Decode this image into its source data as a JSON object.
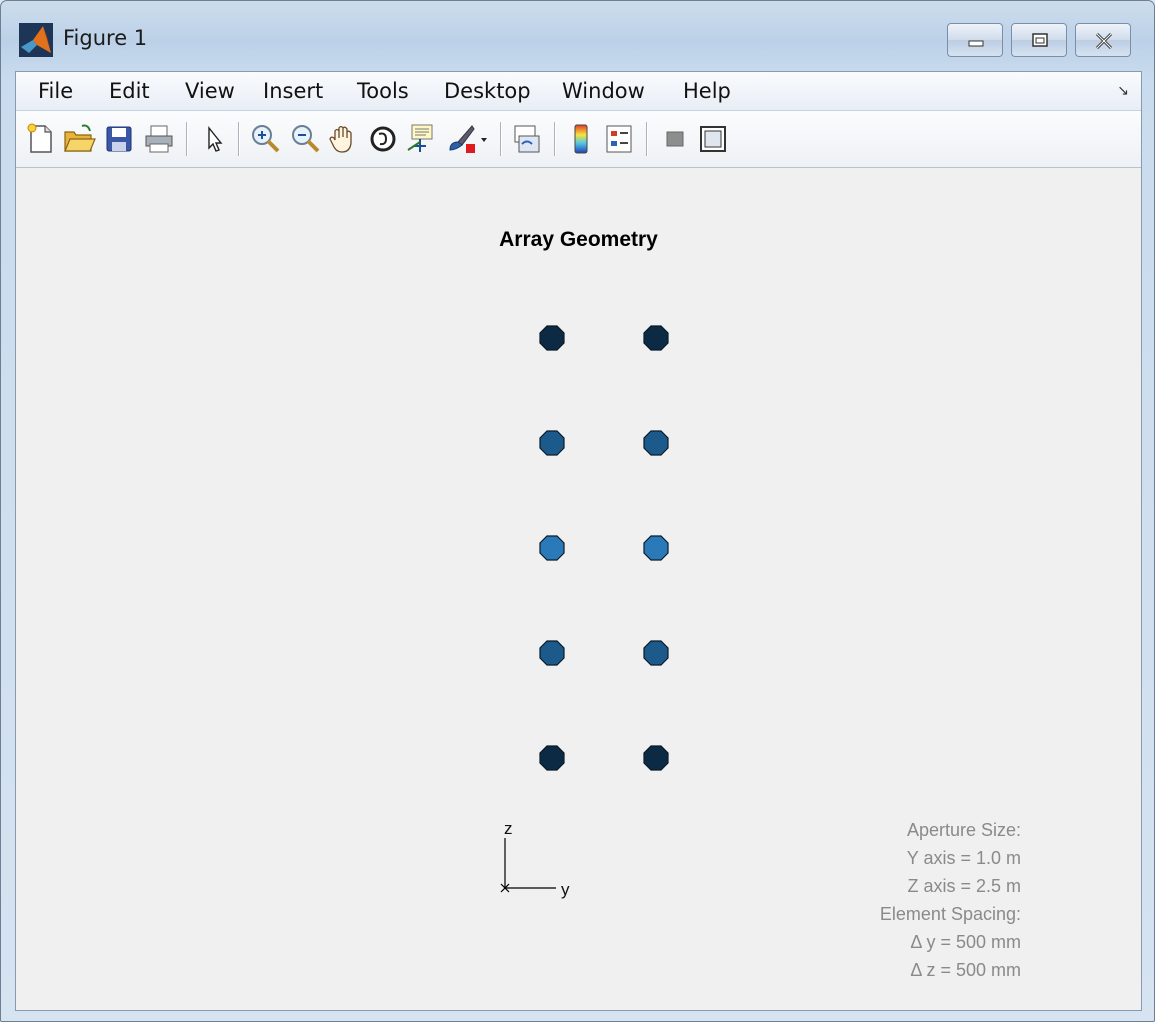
{
  "window": {
    "title": "Figure 1",
    "controls": {
      "minimize": "minimize",
      "maximize": "maximize",
      "close": "close"
    }
  },
  "menubar": {
    "items": [
      "File",
      "Edit",
      "View",
      "Insert",
      "Tools",
      "Desktop",
      "Window",
      "Help"
    ],
    "dock_glyph": "↘"
  },
  "toolbar": {
    "buttons": [
      "new-figure-icon",
      "open-file-icon",
      "save-icon",
      "print-icon",
      "edit-plot-arrow-icon",
      "zoom-in-icon",
      "zoom-out-icon",
      "pan-hand-icon",
      "rotate-3d-icon",
      "data-cursor-icon",
      "brush-icon",
      "brush-dropdown-icon",
      "link-plot-icon",
      "colorbar-icon",
      "legend-icon",
      "hide-plot-tools-icon",
      "show-plot-tools-icon"
    ]
  },
  "chart_data": {
    "type": "scatter",
    "title": "Array Geometry",
    "axis_triad": {
      "x": "x",
      "y": "y",
      "z": "z"
    },
    "x": [
      -0.25,
      0.25,
      -0.25,
      0.25,
      -0.25,
      0.25,
      -0.25,
      0.25,
      -0.25,
      0.25
    ],
    "y": [
      1.0,
      1.0,
      0.5,
      0.5,
      0.0,
      0.0,
      -0.5,
      -0.5,
      -1.0,
      -1.0
    ],
    "point_colors": [
      "#0d2a44",
      "#0d2a44",
      "#1b5a8b",
      "#1b5a8b",
      "#2a7ab9",
      "#2a7ab9",
      "#1b5a8b",
      "#1b5a8b",
      "#0d2a44",
      "#0d2a44"
    ],
    "xlabel": "",
    "ylabel": "",
    "grid": false,
    "annotation": [
      "Aperture Size:",
      "Y axis = 1.0 m",
      "Z axis = 2.5 m",
      "Element Spacing:",
      "Δ y = 500 mm",
      "Δ z = 500 mm"
    ]
  }
}
